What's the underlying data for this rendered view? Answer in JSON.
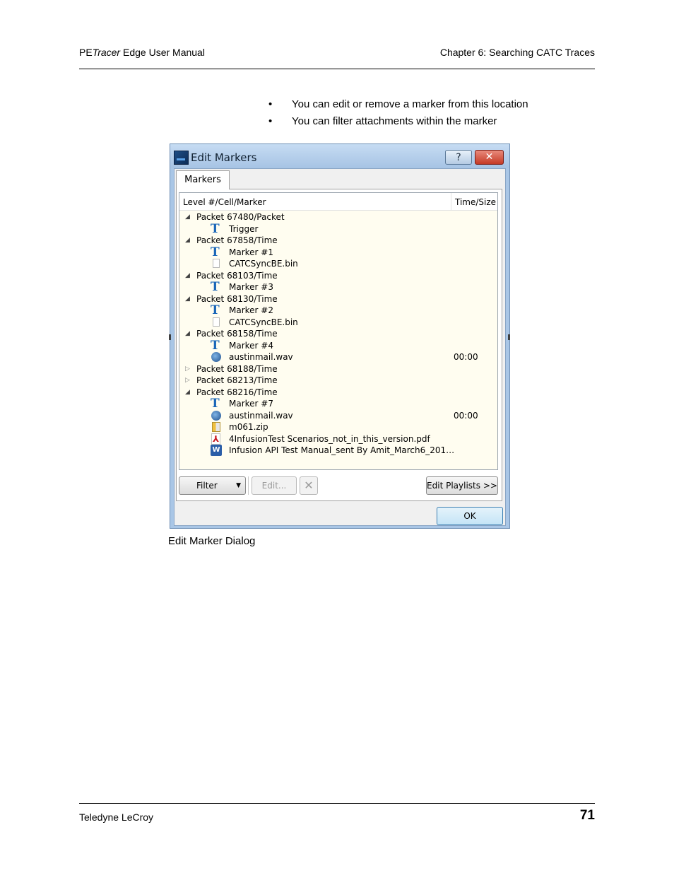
{
  "header": {
    "product_prefix": "PE",
    "product_italic": "Tracer",
    "product_suffix": " Edge User Manual",
    "chapter": "Chapter 6: Searching CATC Traces"
  },
  "bullets": [
    "You can edit or remove a marker from this location",
    "You can filter attachments within the marker"
  ],
  "bullet_symbol": "•",
  "dialog": {
    "title": "Edit Markers",
    "help_label": "?",
    "close_label": "✕",
    "tab_label": "Markers",
    "columns": [
      "Level #/Cell/Marker",
      "Time/Size"
    ],
    "rows": [
      {
        "type": "packet",
        "expanded": true,
        "label": "Packet 67480/Packet",
        "time": ""
      },
      {
        "type": "marker",
        "label": "Trigger",
        "time": ""
      },
      {
        "type": "packet",
        "expanded": true,
        "label": "Packet 67858/Time",
        "time": ""
      },
      {
        "type": "marker",
        "label": "Marker #1",
        "time": ""
      },
      {
        "type": "file",
        "label": "CATCSyncBE.bin",
        "time": ""
      },
      {
        "type": "packet",
        "expanded": true,
        "label": "Packet 68103/Time",
        "time": ""
      },
      {
        "type": "marker",
        "label": "Marker #3",
        "time": ""
      },
      {
        "type": "packet",
        "expanded": true,
        "label": "Packet 68130/Time",
        "time": ""
      },
      {
        "type": "marker",
        "label": "Marker #2",
        "time": ""
      },
      {
        "type": "file",
        "label": "CATCSyncBE.bin",
        "time": ""
      },
      {
        "type": "packet",
        "expanded": true,
        "label": "Packet 68158/Time",
        "time": ""
      },
      {
        "type": "marker",
        "label": "Marker #4",
        "time": ""
      },
      {
        "type": "audio",
        "label": "austinmail.wav",
        "time": "00:00"
      },
      {
        "type": "packet",
        "expanded": false,
        "label": "Packet 68188/Time",
        "time": ""
      },
      {
        "type": "packet",
        "expanded": false,
        "label": "Packet 68213/Time",
        "time": ""
      },
      {
        "type": "packet",
        "expanded": true,
        "label": "Packet 68216/Time",
        "time": ""
      },
      {
        "type": "marker",
        "label": "Marker #7",
        "time": ""
      },
      {
        "type": "audio",
        "label": "austinmail.wav",
        "time": "00:00"
      },
      {
        "type": "zip",
        "label": "m061.zip",
        "time": ""
      },
      {
        "type": "pdf",
        "label": "4InfusionTest Scenarios_not_in_this_version.pdf",
        "time": ""
      },
      {
        "type": "word",
        "label": "Infusion API Test Manual_sent By Amit_March6_201…",
        "time": ""
      }
    ],
    "icons": {
      "marker": "text-marker-icon",
      "file": "file-icon",
      "audio": "audio-icon",
      "zip": "zip-icon",
      "pdf": "pdf-icon",
      "word": "word-document-icon"
    },
    "buttons": {
      "filter": "Filter",
      "edit": "Edit...",
      "delete": "✕",
      "playlists": "Edit Playlists >>",
      "ok": "OK"
    }
  },
  "caption": "Edit Marker Dialog",
  "footer": {
    "company": "Teledyne LeCroy",
    "page_number": "71"
  }
}
